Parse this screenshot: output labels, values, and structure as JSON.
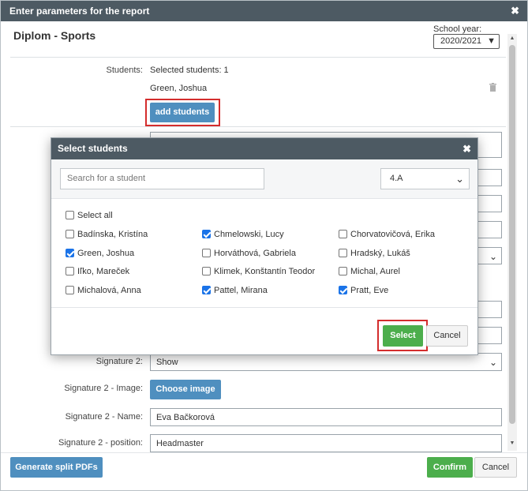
{
  "window": {
    "title": "Enter parameters for the report",
    "close": "✖"
  },
  "report": {
    "title": "Diplom - Sports",
    "school_year_label": "School year:",
    "school_year_value": "2020/2021"
  },
  "students": {
    "label": "Students:",
    "selected_text": "Selected students: 1",
    "selected_name": "Green, Joshua",
    "add_button": "add students"
  },
  "form": {
    "signature2_label": "Signature 2:",
    "signature2_value": "Show",
    "signature2_image_label": "Signature 2 - Image:",
    "choose_image": "Choose image",
    "signature2_name_label": "Signature 2 - Name:",
    "signature2_name_value": "Eva Bačkorová",
    "signature2_position_label": "Signature 2 - position:",
    "signature2_position_value": "Headmaster"
  },
  "footer": {
    "split_pdfs": "Generate split PDFs",
    "confirm": "Confirm",
    "cancel": "Cancel"
  },
  "modal": {
    "title": "Select students",
    "close": "✖",
    "search_placeholder": "Search for a student",
    "class_value": "4.A",
    "select_all": "Select all",
    "students": [
      {
        "name": "Badínska, Kristína",
        "checked": false
      },
      {
        "name": "Chmelowski, Lucy",
        "checked": true
      },
      {
        "name": "Chorvatovičová, Erika",
        "checked": false
      },
      {
        "name": "Green, Joshua",
        "checked": true
      },
      {
        "name": "Horváthová, Gabriela",
        "checked": false
      },
      {
        "name": "Hradský, Lukáš",
        "checked": false
      },
      {
        "name": "Iľko, Mareček",
        "checked": false
      },
      {
        "name": "Klimek, Konštantín Teodor",
        "checked": false
      },
      {
        "name": "Michal, Aurel",
        "checked": false
      },
      {
        "name": "Michalová, Anna",
        "checked": false
      },
      {
        "name": "Pattel, Mirana",
        "checked": true
      },
      {
        "name": "Pratt, Eve",
        "checked": true
      }
    ],
    "select_button": "Select",
    "cancel_button": "Cancel"
  },
  "icons": {
    "trash": "trash-icon",
    "chevron": "chevron-down-icon",
    "close": "close-icon"
  }
}
